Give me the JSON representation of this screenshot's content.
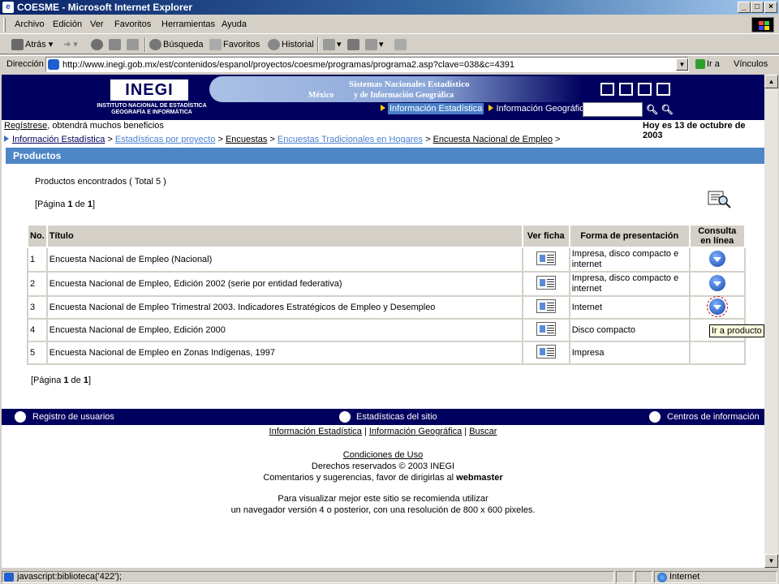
{
  "window": {
    "title": "COESME - Microsoft Internet Explorer",
    "min": "_",
    "max": "□",
    "close": "×"
  },
  "menubar": [
    "Archivo",
    "Edición",
    "Ver",
    "Favoritos",
    "Herramientas",
    "Ayuda"
  ],
  "toolbar": {
    "back": "Atrás",
    "search": "Búsqueda",
    "favorites": "Favoritos",
    "history": "Historial"
  },
  "address": {
    "label": "Dirección",
    "url": "http://www.inegi.gob.mx/est/contenidos/espanol/proyectos/coesme/programas/programa2.asp?clave=038&c=4391",
    "go": "Ir a",
    "links": "Vínculos"
  },
  "header": {
    "logo": "INEGI",
    "logo_sub": "INSTITUTO NACIONAL DE ESTADÍSTICA GEOGRAFÍA E INFORMÁTICA",
    "banner_line1": "Sistemas Nacionales Estadístico",
    "banner_line2": "y de Información Geográfica",
    "banner_country": "México",
    "nav_info_est": "Información Estadística",
    "nav_info_geo": "Información Geográfica"
  },
  "register": {
    "link": "Regístrese",
    "rest": ", obtendrá muchos beneficios"
  },
  "date": "Hoy es 13 de octubre de 2003",
  "breadcrumb": {
    "b1": "Información Estadística",
    "b2": "Estadísticas por proyecto",
    "b3": "Encuestas",
    "b4": "Encuestas Tradicionales en Hogares",
    "b5": "Encuesta Nacional de Empleo",
    "sep": " > "
  },
  "section_title": "Productos",
  "found": "Productos encontrados ( Total 5 )",
  "pager": {
    "prefix": "[Página ",
    "page": "1",
    "mid": " de ",
    "total": "1",
    "suffix": "]"
  },
  "table": {
    "headers": {
      "no": "No.",
      "title": "Título",
      "ficha": "Ver ficha",
      "forma": "Forma de presentación",
      "consulta": "Consulta en línea"
    },
    "rows": [
      {
        "no": "1",
        "title": "Encuesta Nacional de Empleo (Nacional)",
        "forma": "Impresa, disco compacto e internet"
      },
      {
        "no": "2",
        "title": "Encuesta Nacional de Empleo, Edición 2002 (serie por entidad federativa)",
        "forma": "Impresa, disco compacto e internet"
      },
      {
        "no": "3",
        "title": "Encuesta Nacional de Empleo Trimestral 2003. Indicadores Estratégicos de Empleo y Desempleo",
        "forma": "Internet"
      },
      {
        "no": "4",
        "title": "Encuesta Nacional de Empleo, Edición 2000",
        "forma": "Disco compacto"
      },
      {
        "no": "5",
        "title": "Encuesta Nacional de Empleo en Zonas Indígenas, 1997",
        "forma": "Impresa"
      }
    ]
  },
  "tooltip": "Ir a producto",
  "footer": {
    "reg": "Registro de usuarios",
    "stats": "Estadísticas del sitio",
    "centers": "Centros de información",
    "link1": "Información Estadística",
    "link2": "Información Geográfica",
    "link3": "Buscar",
    "conditions": "Condiciones de Uso",
    "rights": "Derechos reservados © 2003 INEGI",
    "comments": "Comentarios y sugerencias, favor de dirigirlas al",
    "webmaster": "webmaster",
    "rec1": "Para visualizar mejor este sitio se recomienda utilizar",
    "rec2": "un navegador versión 4 o posterior, con una resolución de 800 x 600 pixeles."
  },
  "status": {
    "text": "javascript:biblioteca('422');",
    "zone": "Internet"
  }
}
